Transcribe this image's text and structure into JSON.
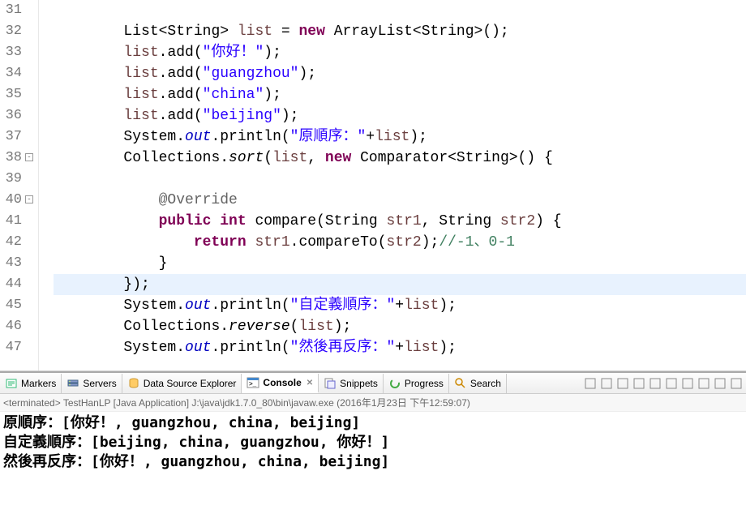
{
  "lines": {
    "31": "",
    "32": {
      "indent": "        ",
      "segs": [
        "List<String> ",
        {
          "c": "var",
          "t": "list"
        },
        " = ",
        {
          "c": "kw",
          "t": "new"
        },
        " ArrayList<String>();"
      ]
    },
    "33": {
      "indent": "        ",
      "segs": [
        {
          "c": "var",
          "t": "list"
        },
        ".add(",
        {
          "c": "str",
          "t": "\"你好！\""
        },
        ");"
      ]
    },
    "34": {
      "indent": "        ",
      "segs": [
        {
          "c": "var",
          "t": "list"
        },
        ".add(",
        {
          "c": "str",
          "t": "\"guangzhou\""
        },
        ");"
      ]
    },
    "35": {
      "indent": "        ",
      "segs": [
        {
          "c": "var",
          "t": "list"
        },
        ".add(",
        {
          "c": "str",
          "t": "\"china\""
        },
        ");"
      ]
    },
    "36": {
      "indent": "        ",
      "segs": [
        {
          "c": "var",
          "t": "list"
        },
        ".add(",
        {
          "c": "str",
          "t": "\"beijing\""
        },
        ");"
      ]
    },
    "37": {
      "indent": "        ",
      "segs": [
        "System.",
        {
          "c": "fld",
          "t": "out"
        },
        ".println(",
        {
          "c": "str",
          "t": "\"原順序：\""
        },
        "+",
        {
          "c": "var",
          "t": "list"
        },
        ");"
      ]
    },
    "38": {
      "indent": "        ",
      "segs": [
        "Collections.",
        {
          "c": "mth",
          "t": "sort"
        },
        "(",
        {
          "c": "var",
          "t": "list"
        },
        ", ",
        {
          "c": "kw",
          "t": "new"
        },
        " Comparator<String>() {"
      ]
    },
    "39": "",
    "40": {
      "indent": "            ",
      "segs": [
        {
          "c": "ann",
          "t": "@Override"
        }
      ]
    },
    "41": {
      "indent": "            ",
      "segs": [
        {
          "c": "kw",
          "t": "public"
        },
        " ",
        {
          "c": "kw",
          "t": "int"
        },
        " compare(String ",
        {
          "c": "var",
          "t": "str1"
        },
        ", String ",
        {
          "c": "var",
          "t": "str2"
        },
        ") {"
      ]
    },
    "42": {
      "indent": "                ",
      "segs": [
        {
          "c": "kw",
          "t": "return"
        },
        " ",
        {
          "c": "var",
          "t": "str1"
        },
        ".compareTo(",
        {
          "c": "var",
          "t": "str2"
        },
        ");",
        {
          "c": "cmt",
          "t": "//-1、0-1"
        }
      ]
    },
    "43": {
      "indent": "            ",
      "segs": [
        "}"
      ]
    },
    "44": {
      "indent": "        ",
      "segs": [
        "});"
      ]
    },
    "45": {
      "indent": "        ",
      "segs": [
        "System.",
        {
          "c": "fld",
          "t": "out"
        },
        ".println(",
        {
          "c": "str",
          "t": "\"自定義順序：\""
        },
        "+",
        {
          "c": "var",
          "t": "list"
        },
        ");"
      ]
    },
    "46": {
      "indent": "        ",
      "segs": [
        "Collections.",
        {
          "c": "mth",
          "t": "reverse"
        },
        "(",
        {
          "c": "var",
          "t": "list"
        },
        ");"
      ]
    },
    "47": {
      "indent": "        ",
      "segs": [
        "System.",
        {
          "c": "fld",
          "t": "out"
        },
        ".println(",
        {
          "c": "str",
          "t": "\"然後再反序：\""
        },
        "+",
        {
          "c": "var",
          "t": "list"
        },
        ");"
      ]
    }
  },
  "lineNumbers": [
    "31",
    "32",
    "33",
    "34",
    "35",
    "36",
    "37",
    "38",
    "39",
    "40",
    "41",
    "42",
    "43",
    "44",
    "45",
    "46",
    "47"
  ],
  "foldMarks": [
    "38",
    "40"
  ],
  "highlightLine": "44",
  "tabs": [
    {
      "label": "Markers",
      "icon": "marker"
    },
    {
      "label": "Servers",
      "icon": "server"
    },
    {
      "label": "Data Source Explorer",
      "icon": "datasource"
    },
    {
      "label": "Console",
      "icon": "console",
      "active": true,
      "closeable": true
    },
    {
      "label": "Snippets",
      "icon": "snippets"
    },
    {
      "label": "Progress",
      "icon": "progress"
    },
    {
      "label": "Search",
      "icon": "search"
    }
  ],
  "terminated": "<terminated> TestHanLP [Java Application] J:\\java\\jdk1.7.0_80\\bin\\javaw.exe (2016年1月23日 下午12:59:07)",
  "consoleOutput": [
    "原順序：[你好！, guangzhou, china, beijing]",
    "自定義順序：[beijing, china, guangzhou, 你好！]",
    "然後再反序：[你好！, guangzhou, china, beijing]"
  ]
}
